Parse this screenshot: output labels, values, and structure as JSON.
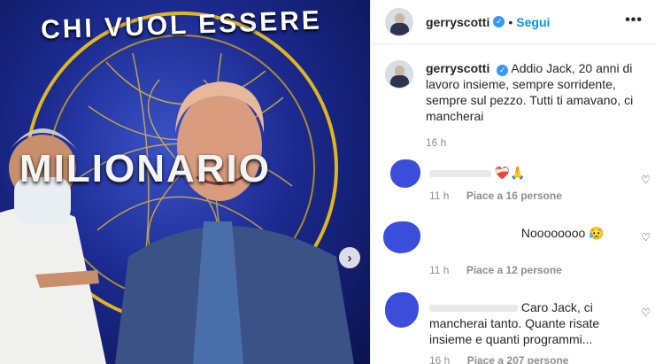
{
  "photo": {
    "arc_title": "CHI VUOL ESSERE",
    "brand": "MILIONARIO",
    "next_icon": "›"
  },
  "header": {
    "username": "gerryscotti",
    "verified_icon": "✓",
    "separator": "•",
    "follow": "Segui",
    "more_icon": "•••"
  },
  "caption": {
    "username": "gerryscotti",
    "text": "Addio Jack, 20 anni di lavoro insieme, sempre sorridente, sempre sul pezzo. Tutti ti amavano, ci mancherai",
    "time": "16 h"
  },
  "comments": [
    {
      "text": "❤️‍🩹🙏",
      "time": "11 h",
      "likes": "Piace a 16 persone"
    },
    {
      "text": "Noooooooo 😥",
      "time": "11 h",
      "likes": "Piace a 12 persone"
    },
    {
      "text": "Caro Jack, ci mancherai tanto. Quante risate insieme e quanti programmi...",
      "time": "16 h",
      "likes": "Piace a 207 persone"
    }
  ],
  "icons": {
    "like": "♡"
  },
  "colors": {
    "accent": "#0095f6",
    "verified": "#3897f0",
    "studio_blue": "#1b2a8f"
  }
}
